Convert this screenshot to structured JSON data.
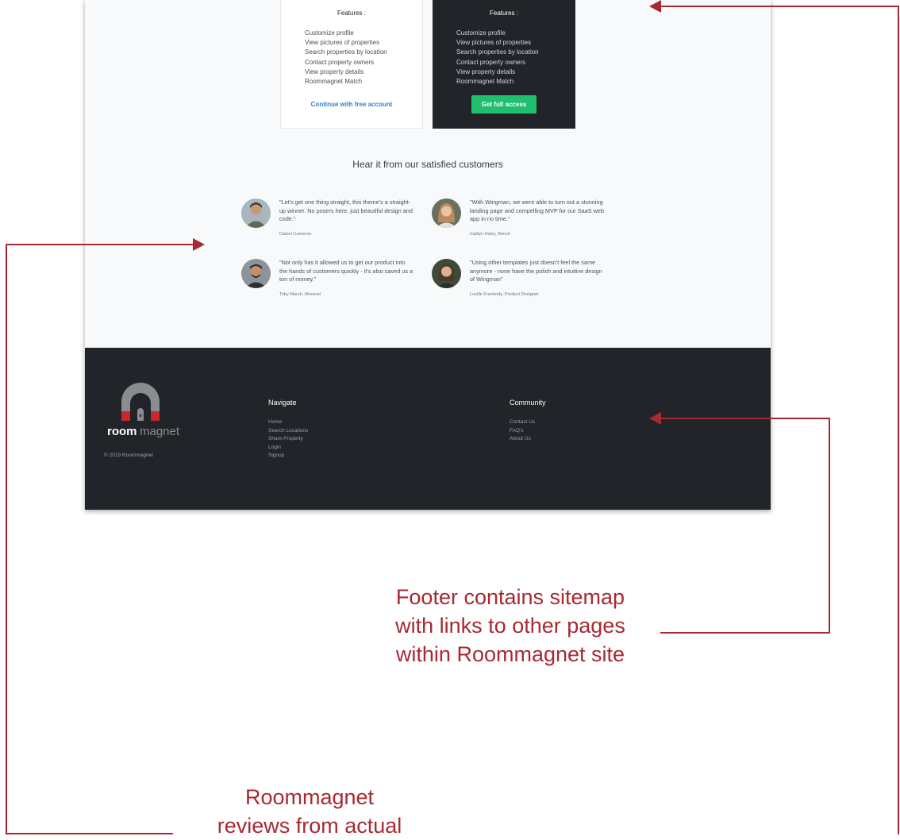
{
  "plans": {
    "free": {
      "features_title": "Features :",
      "features": [
        "Customize profile",
        "View pictures of properties",
        "Search properties by location",
        "Contact property owners",
        "View property details",
        "Roommagnet Match"
      ],
      "cta": "Continue with free account"
    },
    "full": {
      "features_title": "Features :",
      "features": [
        "Customize profile",
        "View pictures of properties",
        "Search properties by location",
        "Contact property owners",
        "View property details",
        "Roommagnet Match"
      ],
      "cta": "Get full access"
    }
  },
  "testimonials": {
    "title": "Hear it from our satisfied customers",
    "items": [
      {
        "quote": "\"Let's get one thing straight, this theme's a straight-up winner. No posers here, just beautiful design and code.\"",
        "author": "Daniel Cameron"
      },
      {
        "quote": "\"With Wingman, we were able to turn out a stunning landing page and compelling MVP for our SaaS web app in no time.\"",
        "author": "Caitlyn Halsy, Bench"
      },
      {
        "quote": "\"Not only has it allowed us to get our product into the hands of customers quickly - it's also saved us a ton of money.\"",
        "author": "Toby Marsh, Movend"
      },
      {
        "quote": "\"Using other templates just doesn't feel the same anymore - none have the polish and intuitive design of Wingman\"",
        "author": "Lucille Freebody, Product Designer"
      }
    ]
  },
  "footer": {
    "logo": {
      "bold": "room",
      "light": "magnet"
    },
    "copyright": "© 2019 Roommagnet",
    "navigate": {
      "title": "Navigate",
      "links": [
        "Home",
        "Search Locations",
        "Share Property",
        "Login",
        "Signup"
      ]
    },
    "community": {
      "title": "Community",
      "links": [
        "Contact Us",
        "FAQ's",
        "About Us"
      ]
    }
  },
  "annotations": {
    "footer_note": [
      "Footer contains sitemap",
      "with links to other pages",
      "within Roommagnet site"
    ],
    "reviews_note": [
      "Roommagnet",
      "reviews from actual"
    ]
  },
  "colors": {
    "annotation": "#a72a30",
    "footer_bg": "#212429",
    "accent_green": "#1fbf6e",
    "link_blue": "#2f7dd1",
    "logo_red": "#c8282e",
    "logo_gray": "#8a8c8f"
  }
}
